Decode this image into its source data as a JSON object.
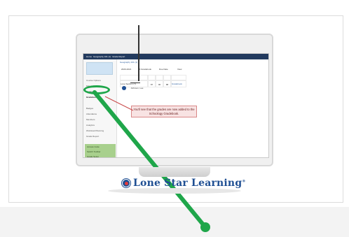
{
  "app": {
    "topbar": [
      "Home",
      "Geography 101 (1)",
      "Grade Report"
    ],
    "page_title": "Geography 101 (1)",
    "filters": [
      "2020-2021",
      "All Gradebook",
      "Due Date",
      "View"
    ],
    "course_label": "Lone Section (7)",
    "student": {
      "name": "Johnson, Lee",
      "values": [
        "87",
        "96",
        "88"
      ]
    },
    "grade_header": "Gradebook",
    "sidebar": {
      "items": [
        "Course Options",
        "Materials",
        "Updates",
        "Gradebook",
        "Badges",
        "Attendance",
        "Members",
        "Analytics",
        "Workload Planning",
        "Grade Report"
      ]
    },
    "green_box": [
      "Access Code",
      "Switch Toolbar",
      "Grade Setup"
    ]
  },
  "callout": {
    "text": "You'll see that the grades are now added to the Schoology Gradebook."
  },
  "branding": {
    "name": "Lone Star Learning",
    "trademark": "®"
  },
  "colors": {
    "accent_green": "#1fa64a",
    "navy": "#223a5e",
    "callout_bg": "#f8e3e3",
    "callout_border": "#d98888"
  }
}
